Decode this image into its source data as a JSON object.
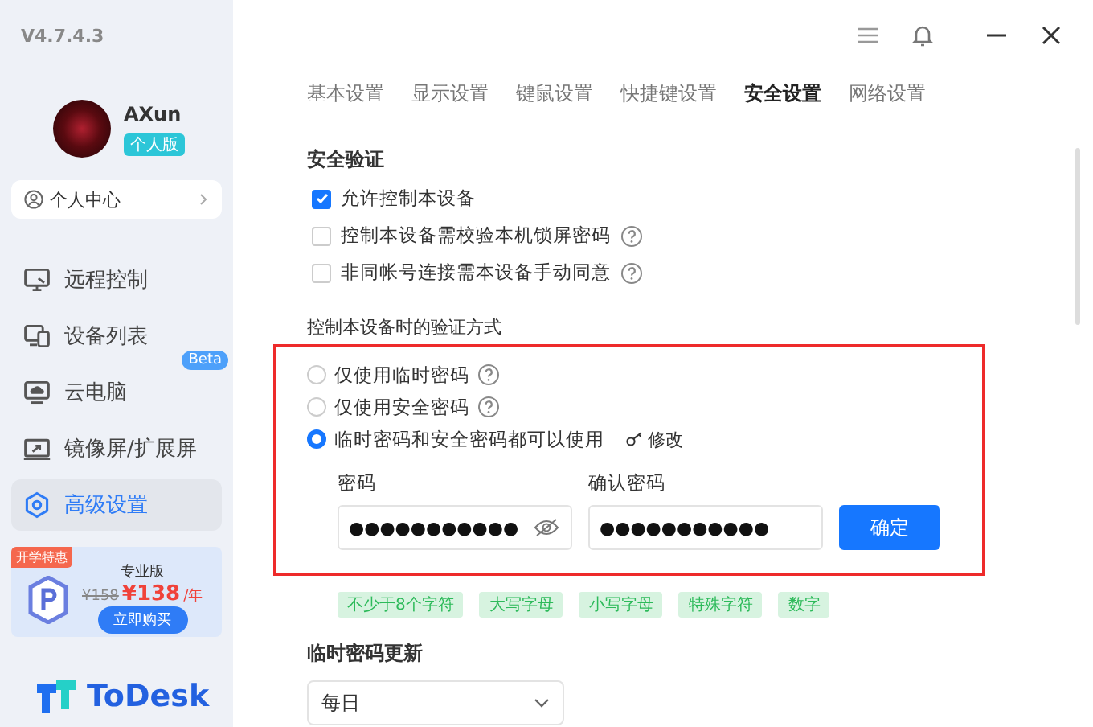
{
  "version": "V4.7.4.3",
  "user": {
    "name": "AXun",
    "badge": "个人版"
  },
  "profile_link": "个人中心",
  "nav": [
    {
      "label": "远程控制",
      "selected": false
    },
    {
      "label": "设备列表",
      "selected": false
    },
    {
      "label": "云电脑",
      "selected": false,
      "badge": "Beta"
    },
    {
      "label": "镜像屏/扩展屏",
      "selected": false
    },
    {
      "label": "高级设置",
      "selected": true
    }
  ],
  "promo": {
    "tag": "开学特惠",
    "title": "专业版",
    "old_price": "¥158",
    "price": "¥138",
    "unit": "/年",
    "button": "立即购买"
  },
  "brand": "ToDesk",
  "tabs": [
    {
      "label": "基本设置",
      "selected": false
    },
    {
      "label": "显示设置",
      "selected": false
    },
    {
      "label": "键鼠设置",
      "selected": false
    },
    {
      "label": "快捷键设置",
      "selected": false
    },
    {
      "label": "安全设置",
      "selected": true
    },
    {
      "label": "网络设置",
      "selected": false
    }
  ],
  "security": {
    "title": "安全验证",
    "options": [
      {
        "label": "允许控制本设备",
        "checked": true,
        "help": false
      },
      {
        "label": "控制本设备需校验本机锁屏密码",
        "checked": false,
        "help": true
      },
      {
        "label": "非同帐号连接需本设备手动同意",
        "checked": false,
        "help": true
      }
    ]
  },
  "verify": {
    "title": "控制本设备时的验证方式",
    "options": [
      {
        "label": "仅使用临时密码",
        "selected": false,
        "help": true
      },
      {
        "label": "仅使用安全密码",
        "selected": false,
        "help": true
      },
      {
        "label": "临时密码和安全密码都可以使用",
        "selected": true,
        "help": false,
        "edit": "修改"
      }
    ],
    "password_label": "密码",
    "password_value": "●●●●●●●●●●●",
    "confirm_label": "确认密码",
    "confirm_value": "●●●●●●●●●●●",
    "confirm_button": "确定",
    "rules": [
      "不少于8个字符",
      "大写字母",
      "小写字母",
      "特殊字符",
      "数字"
    ]
  },
  "temp_update": {
    "title": "临时密码更新",
    "value": "每日"
  }
}
